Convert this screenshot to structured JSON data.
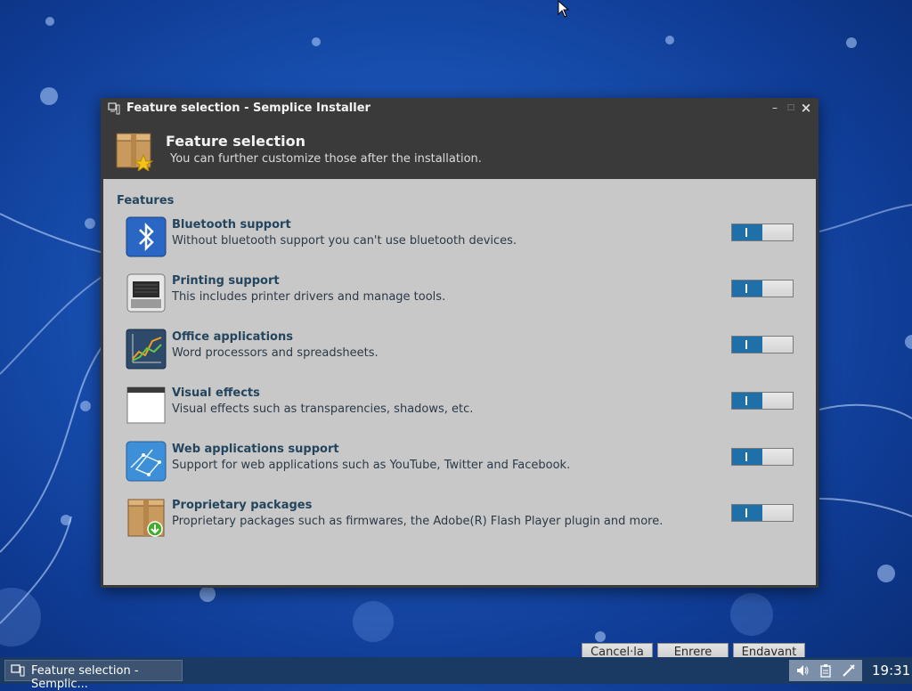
{
  "window": {
    "title": "Feature selection - Semplice Installer",
    "buttons": {
      "minimize": "–",
      "maximize": "□",
      "close": "×"
    }
  },
  "header": {
    "title": "Feature selection",
    "subtitle": "You can further customize those after the installation."
  },
  "features": {
    "section_title": "Features",
    "items": [
      {
        "name": "Bluetooth support",
        "description": "Without bluetooth support you can't use bluetooth devices.",
        "enabled": true,
        "icon": "bluetooth-icon"
      },
      {
        "name": "Printing support",
        "description": "This includes printer drivers and manage tools.",
        "enabled": true,
        "icon": "printer-icon"
      },
      {
        "name": "Office applications",
        "description": "Word processors and spreadsheets.",
        "enabled": true,
        "icon": "office-chart-icon"
      },
      {
        "name": "Visual effects",
        "description": "Visual effects such as transparencies, shadows, etc.",
        "enabled": true,
        "icon": "window-icon"
      },
      {
        "name": "Web applications support",
        "description": "Support for web applications such as YouTube, Twitter and Facebook.",
        "enabled": true,
        "icon": "web-globe-icon"
      },
      {
        "name": "Proprietary packages",
        "description": "Proprietary packages such as firmwares, the Adobe(R) Flash Player plugin and more.",
        "enabled": true,
        "icon": "package-download-icon"
      }
    ]
  },
  "actions": {
    "cancel": "Cancel·la",
    "back": "Enrere",
    "next": "Endavant"
  },
  "taskbar": {
    "task_label": "Feature selection - Semplic...",
    "clock": "19:31",
    "tray_icons": [
      "volume-icon",
      "clipboard-icon",
      "network-icon"
    ]
  },
  "colors": {
    "toggle_on": "#1f6fa8",
    "heading_text": "#24455e",
    "panel_bg": "#c8c8c8",
    "titlebar_bg": "#3a3a3a",
    "taskbar_bg": "#1b3a63"
  }
}
